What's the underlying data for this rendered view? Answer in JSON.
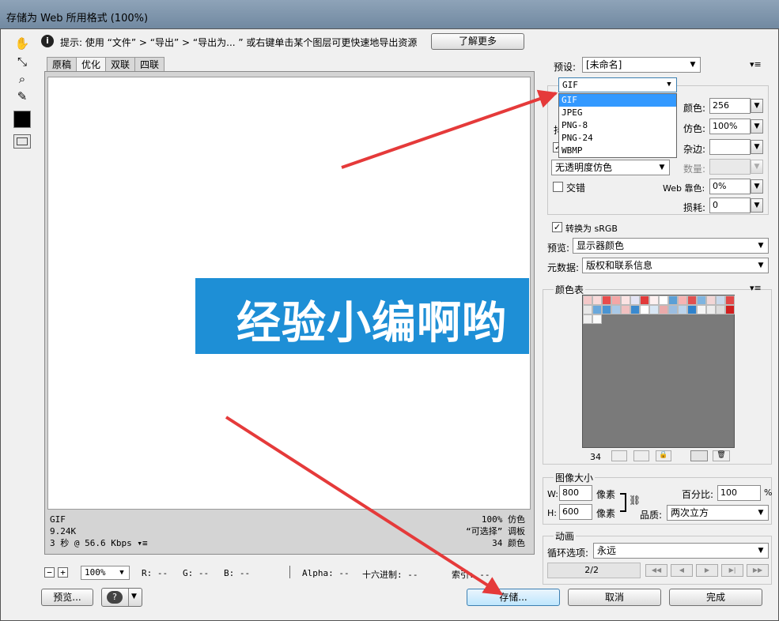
{
  "window": {
    "title": "存储为 Web 所用格式 (100%)"
  },
  "hint": {
    "text": "提示: 使用 “文件” > “导出” > “导出为... ” 或右键单击某个图层可更快速地导出资源",
    "learn_more": "了解更多"
  },
  "tabs": [
    "原稿",
    "优化",
    "双联",
    "四联"
  ],
  "canvas": {
    "banner_text": "经验小编啊哟"
  },
  "image_info": {
    "left": [
      "GIF",
      "9.24K",
      "3 秒 @ 56.6 Kbps"
    ],
    "right": [
      "100% 仿色",
      "“可选择” 调板",
      "34 颜色"
    ]
  },
  "statusbar": {
    "zoom": "100%",
    "r": "R: --",
    "g": "G: --",
    "b": "B: --",
    "alpha": "Alpha: --",
    "hex": "十六进制: --",
    "index": "索引: --"
  },
  "bottom_buttons": {
    "preview": "预览...",
    "save": "存储...",
    "cancel": "取消",
    "done": "完成"
  },
  "settings": {
    "preset_label": "预设:",
    "preset_value": "[未命名]",
    "format_value": "GIF",
    "format_options": [
      "GIF",
      "JPEG",
      "PNG-8",
      "PNG-24",
      "WBMP"
    ],
    "colors_label": "颜色:",
    "colors_value": "256",
    "dither_label": "仿色:",
    "dither_value": "100%",
    "matte_label": "杂边:",
    "amount_label": "数量:",
    "transparency_dither": "无透明度仿色",
    "interlaced_label": "交错",
    "web_snap_label": "Web 靠色:",
    "web_snap_value": "0%",
    "lossy_label": "损耗:",
    "lossy_value": "0",
    "convert_srgb": "转换为 sRGB",
    "preview_label": "预览:",
    "preview_value": "显示器颜色",
    "metadata_label": "元数据:",
    "metadata_value": "版权和联系信息"
  },
  "color_table": {
    "title": "颜色表",
    "count": "34"
  },
  "image_size": {
    "title": "图像大小",
    "w_label": "W:",
    "w_value": "800",
    "h_label": "H:",
    "h_value": "600",
    "unit": "像素",
    "percent_label": "百分比:",
    "percent_value": "100",
    "percent_unit": "%",
    "quality_label": "品质:",
    "quality_value": "两次立方"
  },
  "animation": {
    "title": "动画",
    "loop_label": "循环选项:",
    "loop_value": "永远",
    "frame": "2/2"
  },
  "colors": {
    "accent_red": "#e53a3a",
    "banner_blue": "#1e8fd6",
    "highlight": "#3399ff"
  }
}
